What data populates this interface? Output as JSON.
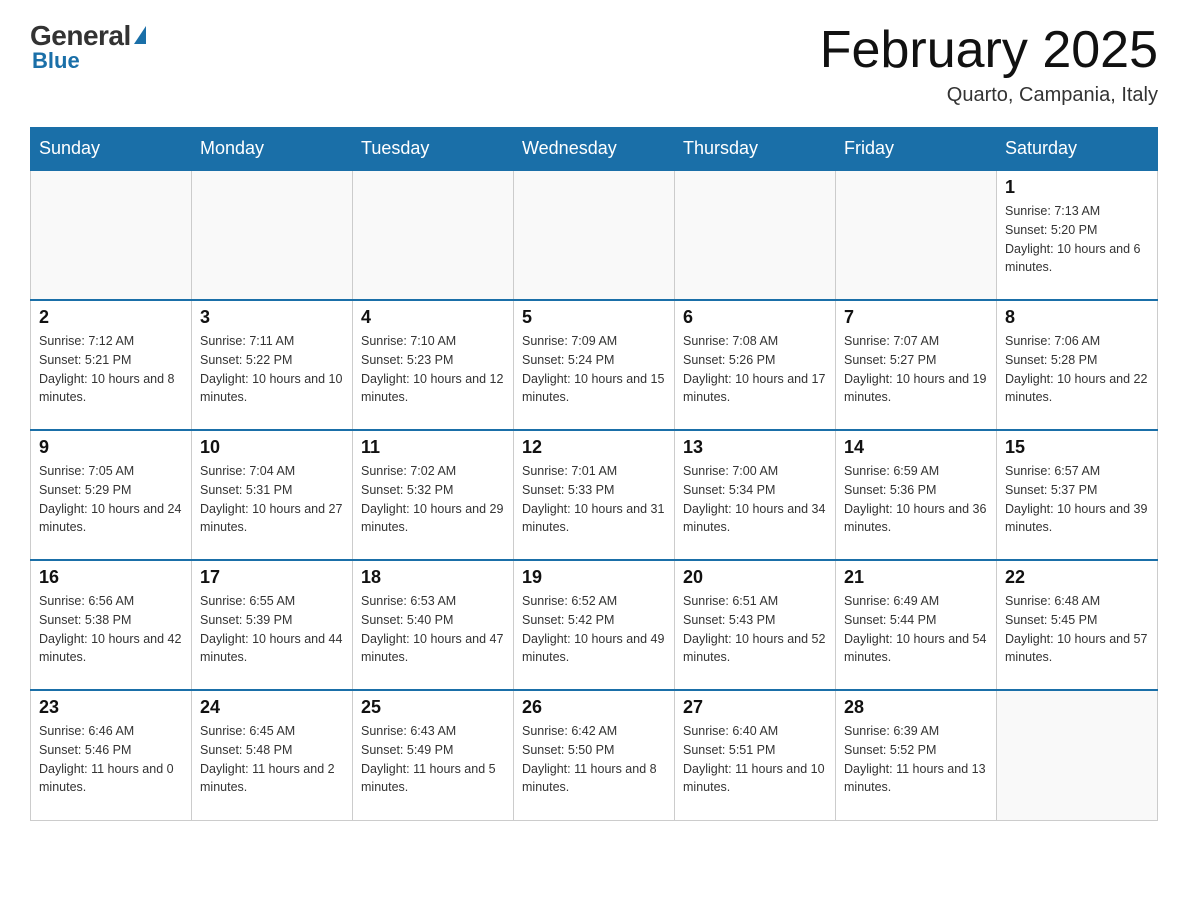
{
  "logo": {
    "general": "General",
    "blue": "Blue"
  },
  "title": "February 2025",
  "subtitle": "Quarto, Campania, Italy",
  "days_of_week": [
    "Sunday",
    "Monday",
    "Tuesday",
    "Wednesday",
    "Thursday",
    "Friday",
    "Saturday"
  ],
  "weeks": [
    [
      {
        "day": "",
        "info": ""
      },
      {
        "day": "",
        "info": ""
      },
      {
        "day": "",
        "info": ""
      },
      {
        "day": "",
        "info": ""
      },
      {
        "day": "",
        "info": ""
      },
      {
        "day": "",
        "info": ""
      },
      {
        "day": "1",
        "info": "Sunrise: 7:13 AM\nSunset: 5:20 PM\nDaylight: 10 hours and 6 minutes."
      }
    ],
    [
      {
        "day": "2",
        "info": "Sunrise: 7:12 AM\nSunset: 5:21 PM\nDaylight: 10 hours and 8 minutes."
      },
      {
        "day": "3",
        "info": "Sunrise: 7:11 AM\nSunset: 5:22 PM\nDaylight: 10 hours and 10 minutes."
      },
      {
        "day": "4",
        "info": "Sunrise: 7:10 AM\nSunset: 5:23 PM\nDaylight: 10 hours and 12 minutes."
      },
      {
        "day": "5",
        "info": "Sunrise: 7:09 AM\nSunset: 5:24 PM\nDaylight: 10 hours and 15 minutes."
      },
      {
        "day": "6",
        "info": "Sunrise: 7:08 AM\nSunset: 5:26 PM\nDaylight: 10 hours and 17 minutes."
      },
      {
        "day": "7",
        "info": "Sunrise: 7:07 AM\nSunset: 5:27 PM\nDaylight: 10 hours and 19 minutes."
      },
      {
        "day": "8",
        "info": "Sunrise: 7:06 AM\nSunset: 5:28 PM\nDaylight: 10 hours and 22 minutes."
      }
    ],
    [
      {
        "day": "9",
        "info": "Sunrise: 7:05 AM\nSunset: 5:29 PM\nDaylight: 10 hours and 24 minutes."
      },
      {
        "day": "10",
        "info": "Sunrise: 7:04 AM\nSunset: 5:31 PM\nDaylight: 10 hours and 27 minutes."
      },
      {
        "day": "11",
        "info": "Sunrise: 7:02 AM\nSunset: 5:32 PM\nDaylight: 10 hours and 29 minutes."
      },
      {
        "day": "12",
        "info": "Sunrise: 7:01 AM\nSunset: 5:33 PM\nDaylight: 10 hours and 31 minutes."
      },
      {
        "day": "13",
        "info": "Sunrise: 7:00 AM\nSunset: 5:34 PM\nDaylight: 10 hours and 34 minutes."
      },
      {
        "day": "14",
        "info": "Sunrise: 6:59 AM\nSunset: 5:36 PM\nDaylight: 10 hours and 36 minutes."
      },
      {
        "day": "15",
        "info": "Sunrise: 6:57 AM\nSunset: 5:37 PM\nDaylight: 10 hours and 39 minutes."
      }
    ],
    [
      {
        "day": "16",
        "info": "Sunrise: 6:56 AM\nSunset: 5:38 PM\nDaylight: 10 hours and 42 minutes."
      },
      {
        "day": "17",
        "info": "Sunrise: 6:55 AM\nSunset: 5:39 PM\nDaylight: 10 hours and 44 minutes."
      },
      {
        "day": "18",
        "info": "Sunrise: 6:53 AM\nSunset: 5:40 PM\nDaylight: 10 hours and 47 minutes."
      },
      {
        "day": "19",
        "info": "Sunrise: 6:52 AM\nSunset: 5:42 PM\nDaylight: 10 hours and 49 minutes."
      },
      {
        "day": "20",
        "info": "Sunrise: 6:51 AM\nSunset: 5:43 PM\nDaylight: 10 hours and 52 minutes."
      },
      {
        "day": "21",
        "info": "Sunrise: 6:49 AM\nSunset: 5:44 PM\nDaylight: 10 hours and 54 minutes."
      },
      {
        "day": "22",
        "info": "Sunrise: 6:48 AM\nSunset: 5:45 PM\nDaylight: 10 hours and 57 minutes."
      }
    ],
    [
      {
        "day": "23",
        "info": "Sunrise: 6:46 AM\nSunset: 5:46 PM\nDaylight: 11 hours and 0 minutes."
      },
      {
        "day": "24",
        "info": "Sunrise: 6:45 AM\nSunset: 5:48 PM\nDaylight: 11 hours and 2 minutes."
      },
      {
        "day": "25",
        "info": "Sunrise: 6:43 AM\nSunset: 5:49 PM\nDaylight: 11 hours and 5 minutes."
      },
      {
        "day": "26",
        "info": "Sunrise: 6:42 AM\nSunset: 5:50 PM\nDaylight: 11 hours and 8 minutes."
      },
      {
        "day": "27",
        "info": "Sunrise: 6:40 AM\nSunset: 5:51 PM\nDaylight: 11 hours and 10 minutes."
      },
      {
        "day": "28",
        "info": "Sunrise: 6:39 AM\nSunset: 5:52 PM\nDaylight: 11 hours and 13 minutes."
      },
      {
        "day": "",
        "info": ""
      }
    ]
  ]
}
